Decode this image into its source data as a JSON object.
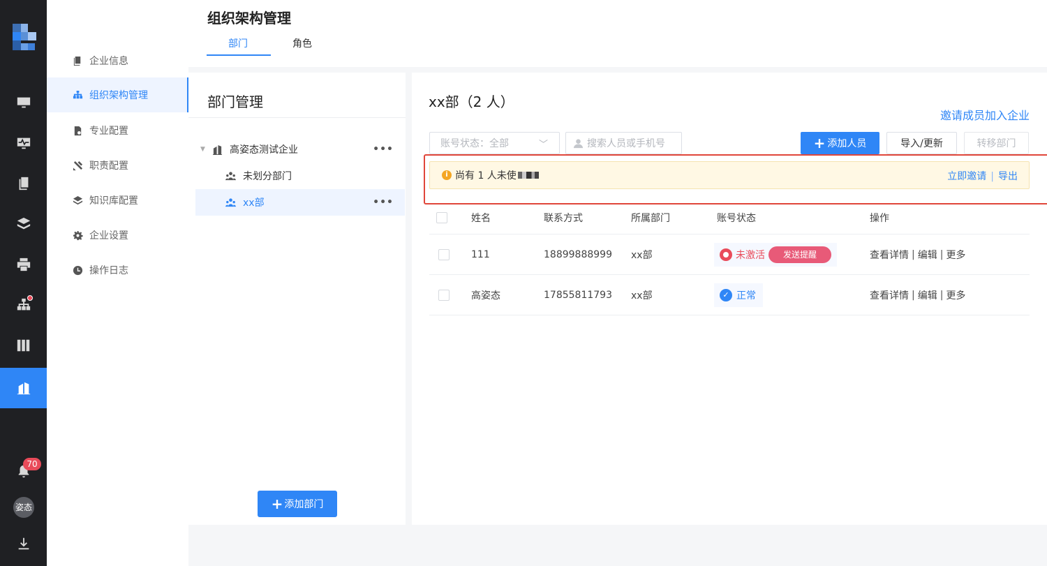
{
  "rail": {
    "badge_count": "70",
    "avatar_text": "姿态",
    "colors": {
      "background": "#1f2023",
      "active": "#2f86f6",
      "badge": "#e94b5a"
    }
  },
  "subnav": {
    "items": [
      {
        "label": "企业信息",
        "icon": "document-icon"
      },
      {
        "label": "组织架构管理",
        "icon": "org-chart-icon",
        "active": true
      },
      {
        "label": "专业配置",
        "icon": "file-gear-icon"
      },
      {
        "label": "职责配置",
        "icon": "tools-icon"
      },
      {
        "label": "知识库配置",
        "icon": "layers-icon"
      },
      {
        "label": "企业设置",
        "icon": "gear-icon"
      },
      {
        "label": "操作日志",
        "icon": "clock-icon"
      }
    ]
  },
  "header": {
    "title": "组织架构管理",
    "tabs": [
      {
        "label": "部门",
        "active": true
      },
      {
        "label": "角色"
      }
    ]
  },
  "dept_panel": {
    "title": "部门管理",
    "tree": {
      "root": "高姿态测试企业",
      "children": [
        "未划分部门",
        "xx部"
      ],
      "selected": "xx部"
    },
    "add_button": "添加部门"
  },
  "main": {
    "title": "xx部（2 人）",
    "invite_link": "邀请成员加入企业",
    "status_filter": "账号状态：全部",
    "search_placeholder": "搜索人员或手机号",
    "buttons": {
      "add": "添加人员",
      "import": "导入/更新",
      "transfer": "转移部门"
    },
    "notice": {
      "text": "尚有 1 人未使",
      "tail": "",
      "invite_now": "立即邀请",
      "export": "导出"
    },
    "table": {
      "headers": [
        "姓名",
        "联系方式",
        "所属部门",
        "账号状态",
        "操作"
      ],
      "rows": [
        {
          "name": "111",
          "phone": "18899888999",
          "dept": "xx部",
          "status": "未激活",
          "status_type": "inactive",
          "remind": "发送提醒"
        },
        {
          "name": "高姿态",
          "phone": "17855811793",
          "dept": "xx部",
          "status": "正常",
          "status_type": "ok"
        }
      ],
      "ops": {
        "detail": "查看详情",
        "edit": "编辑",
        "more": "更多"
      }
    }
  }
}
